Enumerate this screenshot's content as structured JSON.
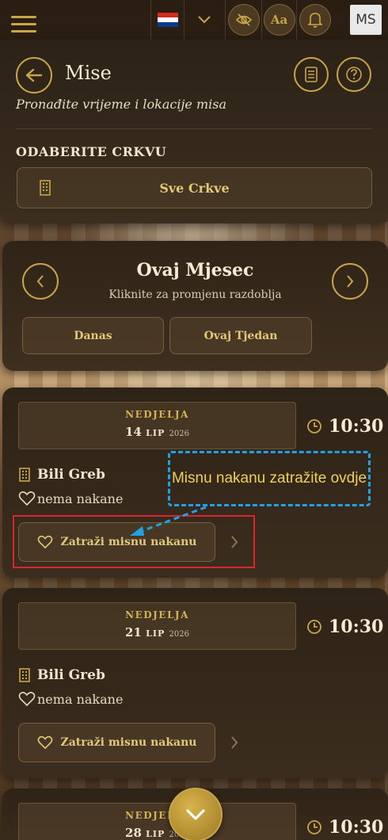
{
  "app": {
    "flag_colors": [
      "#d52b1e",
      "#ffffff",
      "#0b3a8c"
    ],
    "text_size_label": "Aa",
    "avatar_initials": "MS"
  },
  "header": {
    "title": "Mise",
    "subtitle": "Pronađite vrijeme i lokacije misa",
    "church_section_label": "ODABERITE CRKVU",
    "church_select_value": "Sve Crkve"
  },
  "period": {
    "title": "Ovaj Mjesec",
    "hint": "Kliknite za promjenu razdoblja",
    "quick_buttons": [
      "Danas",
      "Ovaj Tjedan"
    ]
  },
  "masses": [
    {
      "day": "NEDJELJA",
      "date_day": "14",
      "date_month": "LIP",
      "date_year": "2026",
      "time": "10:30",
      "church": "Bili Greb",
      "intention": "nema nakane",
      "request_label": "Zatraži misnu nakanu"
    },
    {
      "day": "NEDJELJA",
      "date_day": "21",
      "date_month": "LIP",
      "date_year": "2026",
      "time": "10:30",
      "church": "Bili Greb",
      "intention": "nema nakane",
      "request_label": "Zatraži misnu nakanu"
    },
    {
      "day": "NEDJELJA",
      "date_day": "28",
      "date_month": "LIP",
      "date_year": "2026",
      "time": "10:30"
    }
  ],
  "annotation": {
    "callout_text": "Misnu nakanu zatražite ovdje"
  },
  "colors": {
    "accent_gold": "#c9a54a",
    "annotation_red": "#d9262b",
    "annotation_blue": "#1fa3e6",
    "callout_text": "#f0d05a"
  }
}
